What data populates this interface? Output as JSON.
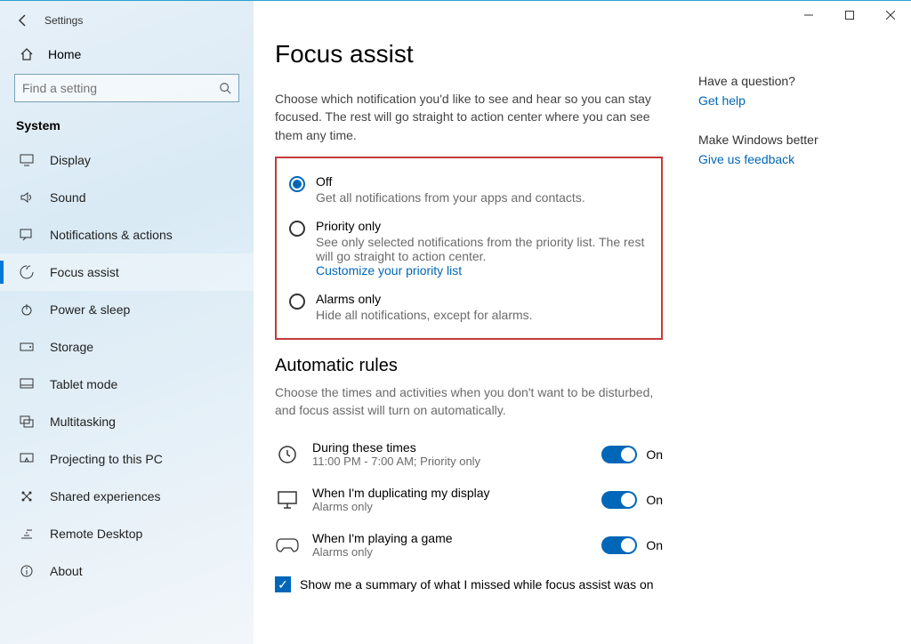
{
  "app": {
    "title": "Settings"
  },
  "home_label": "Home",
  "search": {
    "placeholder": "Find a setting"
  },
  "group_title": "System",
  "sidebar": {
    "items": [
      {
        "label": "Display"
      },
      {
        "label": "Sound"
      },
      {
        "label": "Notifications & actions"
      },
      {
        "label": "Focus assist"
      },
      {
        "label": "Power & sleep"
      },
      {
        "label": "Storage"
      },
      {
        "label": "Tablet mode"
      },
      {
        "label": "Multitasking"
      },
      {
        "label": "Projecting to this PC"
      },
      {
        "label": "Shared experiences"
      },
      {
        "label": "Remote Desktop"
      },
      {
        "label": "About"
      }
    ]
  },
  "page": {
    "title": "Focus assist",
    "intro": "Choose which notification you'd like to see and hear so you can stay focused. The rest will go straight to action center where you can see them any time.",
    "radios": {
      "off": {
        "label": "Off",
        "desc": "Get all notifications from your apps and contacts."
      },
      "priority": {
        "label": "Priority only",
        "desc": "See only selected notifications from the priority list. The rest will go straight to action center.",
        "link": "Customize your priority list"
      },
      "alarms": {
        "label": "Alarms only",
        "desc": "Hide all notifications, except for alarms."
      }
    },
    "rules": {
      "title": "Automatic rules",
      "desc": "Choose the times and activities when you don't want to be disturbed, and focus assist will turn on automatically.",
      "items": [
        {
          "t1": "During these times",
          "t2": "11:00 PM - 7:00 AM; Priority only",
          "state": "On"
        },
        {
          "t1": "When I'm duplicating my display",
          "t2": "Alarms only",
          "state": "On"
        },
        {
          "t1": "When I'm playing a game",
          "t2": "Alarms only",
          "state": "On"
        }
      ],
      "summary": "Show me a summary of what I missed while focus assist was on"
    }
  },
  "right": {
    "q_title": "Have a question?",
    "q_link": "Get help",
    "f_title": "Make Windows better",
    "f_link": "Give us feedback"
  }
}
